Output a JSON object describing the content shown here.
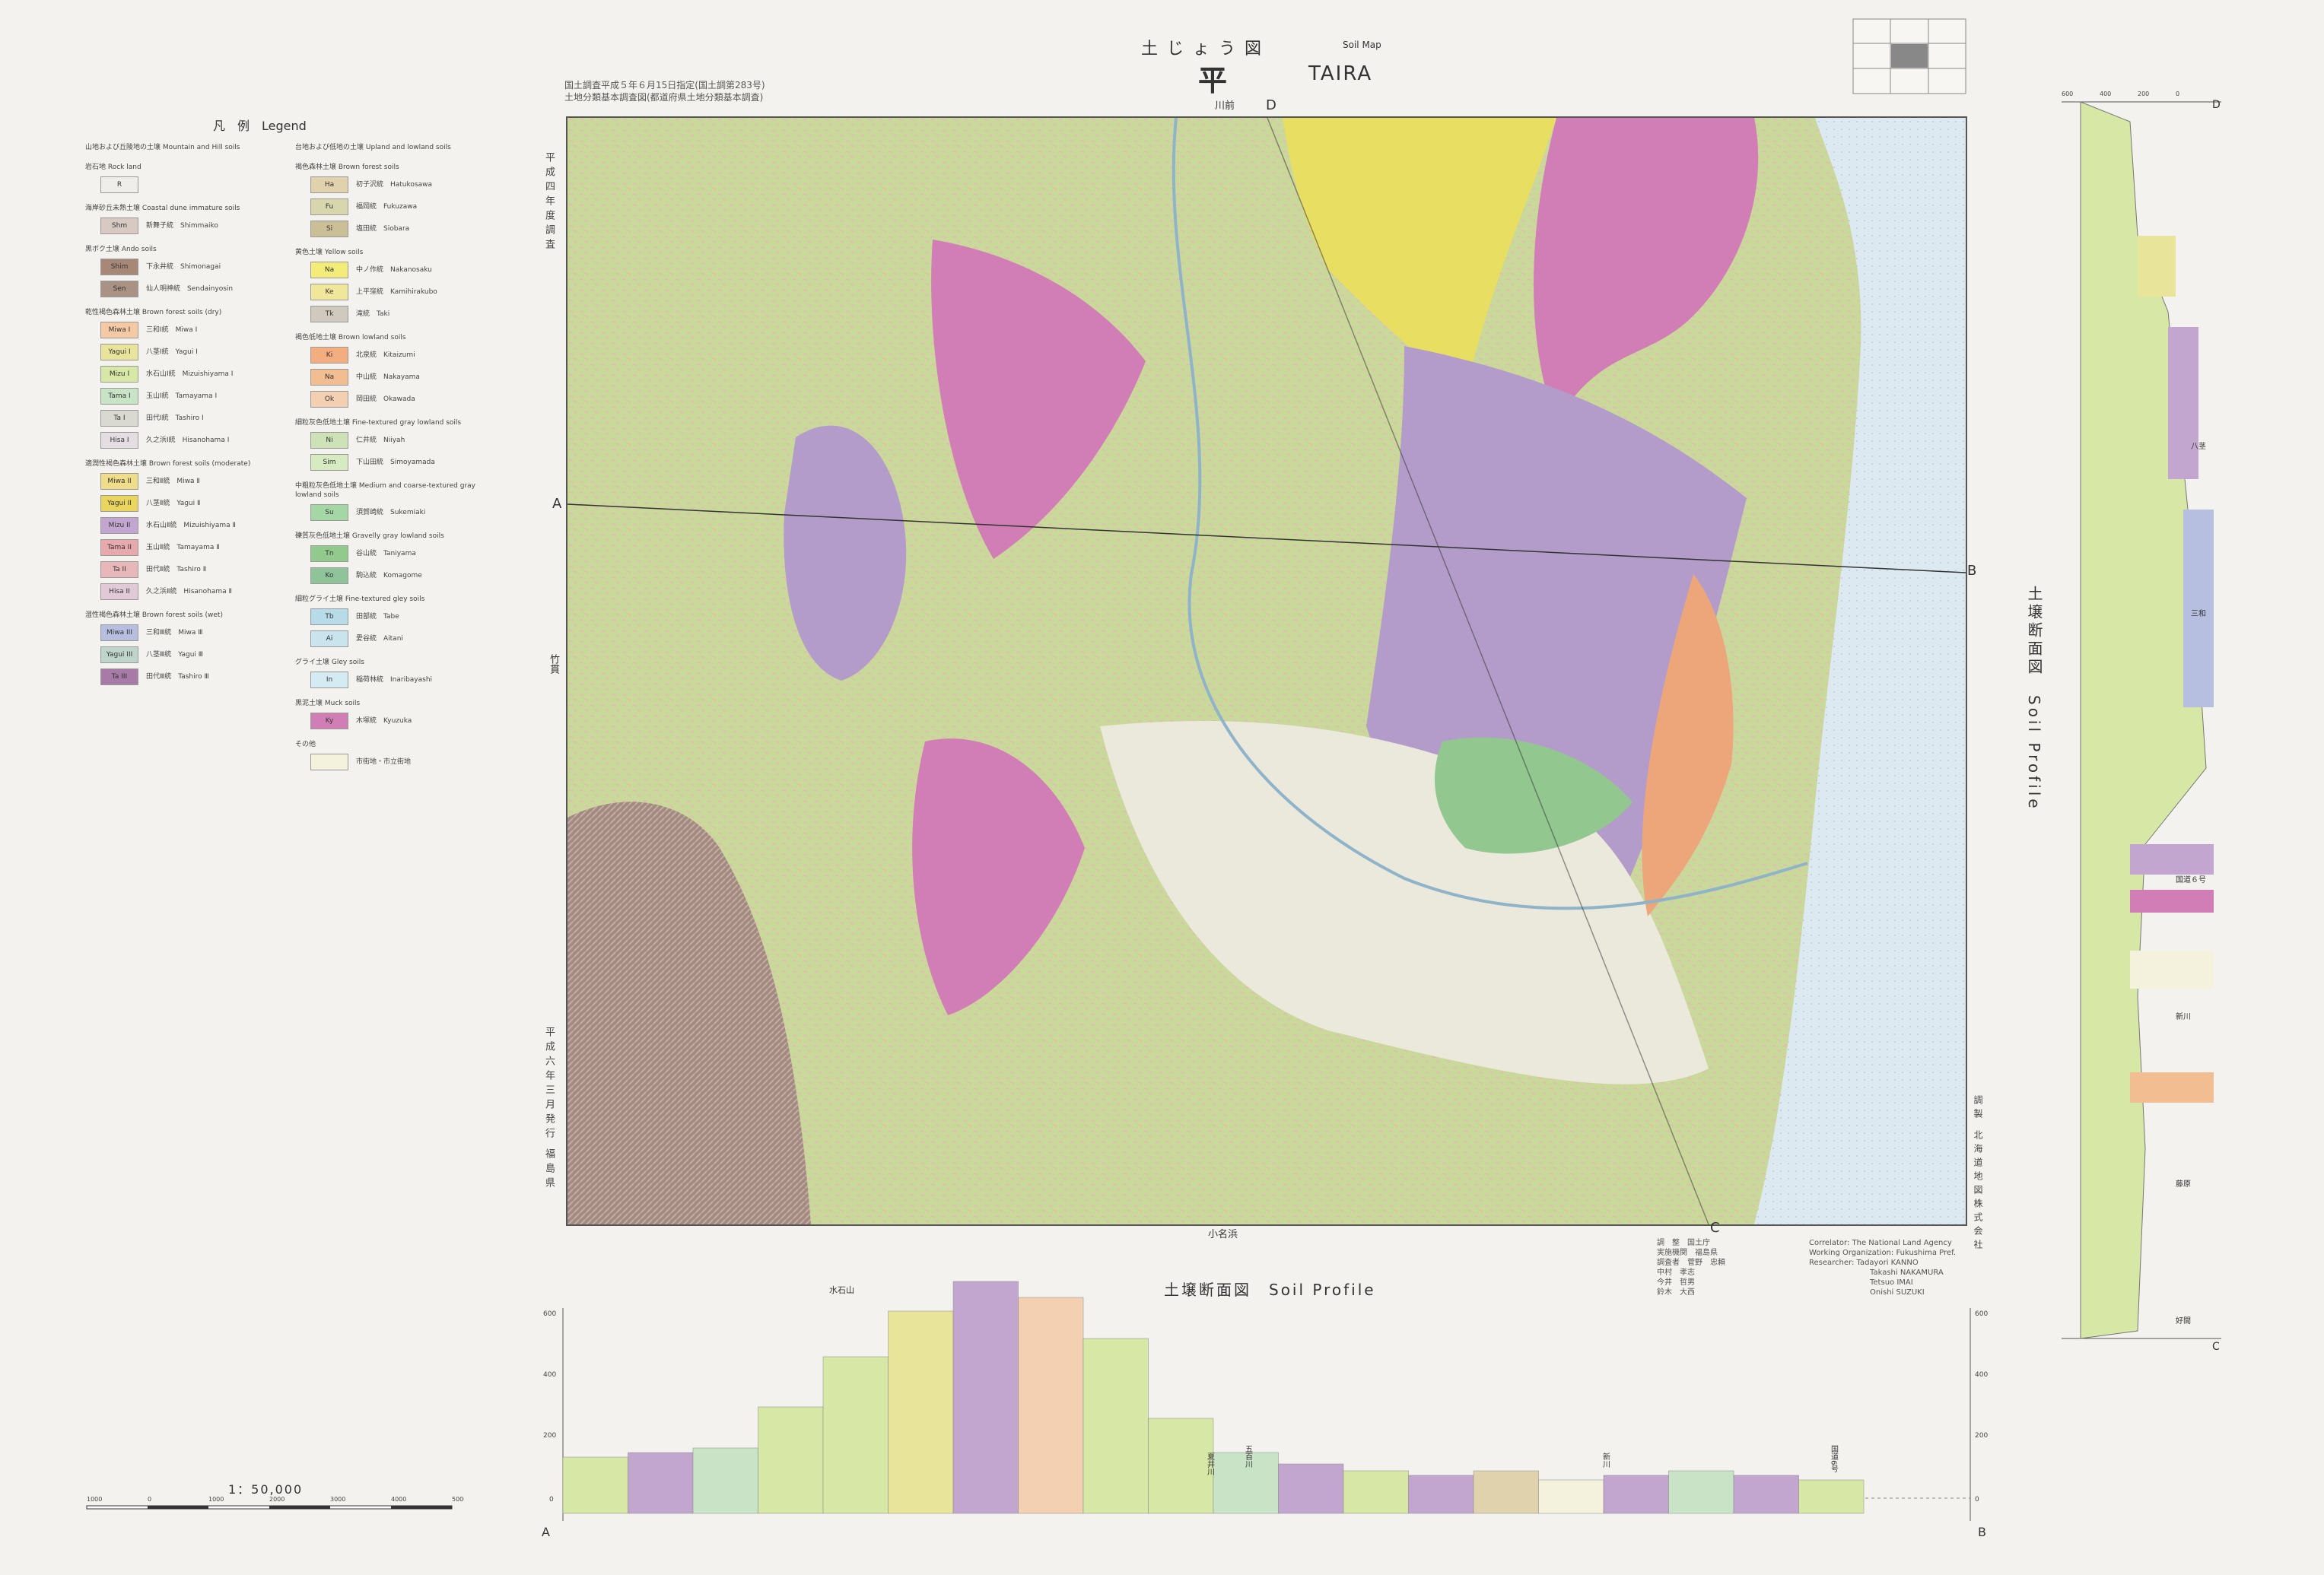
{
  "header": {
    "title_jp": "土じょう図",
    "title_soilmap": "Soil Map",
    "title_kanji": "平",
    "title_en": "TAIRA",
    "note_line1": "国土調査平成５年６月15日指定(国土調第283号)",
    "note_line2": "土地分類基本調査図(都道府県土地分類基本調査)",
    "left_vertical": "平成四年度調査",
    "bottom_vertical": "平成六年三月発行",
    "prefecture_vertical": "福島県",
    "right_vertical": "調製 北海道地図株式会社"
  },
  "legend": {
    "title": "凡　例　Legend",
    "column1": [
      {
        "group": "山地および丘陵地の土壌 Mountain and Hill soils",
        "items": []
      },
      {
        "group": "岩石地 Rock land",
        "items": [
          {
            "code": "R",
            "name": "",
            "color": "#efeeea"
          }
        ]
      },
      {
        "group": "海岸砂丘未熟土壌 Coastal dune immature soils",
        "items": [
          {
            "code": "Shm",
            "name": "新舞子統　Shimmaiko",
            "color": "#d8c9c3"
          }
        ]
      },
      {
        "group": "黒ボク土壌 Ando soils",
        "items": [
          {
            "code": "Shim",
            "name": "下永井統　Shimonagai",
            "color": "#a78877"
          },
          {
            "code": "Sen",
            "name": "仙人明神統　Sendainyosin",
            "color": "#a99283"
          }
        ]
      },
      {
        "group": "乾性褐色森林土壌 Brown forest soils (dry)",
        "items": [
          {
            "code": "Miwa I",
            "name": "三和Ⅰ統　Miwa Ⅰ",
            "color": "#f6c9a5"
          },
          {
            "code": "Yagui I",
            "name": "八茎Ⅰ統　Yagui Ⅰ",
            "color": "#e8e59a"
          },
          {
            "code": "Mizu I",
            "name": "水石山Ⅰ統　Mizuishiyama Ⅰ",
            "color": "#d7e7a6"
          },
          {
            "code": "Tama I",
            "name": "玉山Ⅰ統　Tamayama Ⅰ",
            "color": "#c9e3c7"
          },
          {
            "code": "Ta I",
            "name": "田代Ⅰ統　Tashiro Ⅰ",
            "color": "#d9d9d2"
          },
          {
            "code": "Hisa I",
            "name": "久之浜Ⅰ統　Hisanohama Ⅰ",
            "color": "#e4dde2"
          }
        ]
      },
      {
        "group": "適潤性褐色森林土壌 Brown forest soils (moderate)",
        "items": [
          {
            "code": "Miwa II",
            "name": "三和Ⅱ統　Miwa Ⅱ",
            "color": "#f0dd8a"
          },
          {
            "code": "Yagui II",
            "name": "八茎Ⅱ統　Yagui Ⅱ",
            "color": "#ead55f"
          },
          {
            "code": "Mizu II",
            "name": "水石山Ⅱ統　Mizuishiyama Ⅱ",
            "color": "#c3a6cf"
          },
          {
            "code": "Tama II",
            "name": "玉山Ⅱ統　Tamayama Ⅱ",
            "color": "#e8a9ad"
          },
          {
            "code": "Ta II",
            "name": "田代Ⅱ統　Tashiro Ⅱ",
            "color": "#e7b7b9"
          },
          {
            "code": "Hisa II",
            "name": "久之浜Ⅱ統　Hisanohama Ⅱ",
            "color": "#e1c9d8"
          }
        ]
      },
      {
        "group": "湿性褐色森林土壌 Brown forest soils (wet)",
        "items": [
          {
            "code": "Miwa III",
            "name": "三和Ⅲ統　Miwa Ⅲ",
            "color": "#b6bfe0"
          },
          {
            "code": "Yagui III",
            "name": "八茎Ⅲ統　Yagui Ⅲ",
            "color": "#bfd5cc"
          },
          {
            "code": "Ta III",
            "name": "田代Ⅲ統　Tashiro Ⅲ",
            "color": "#a77aa8"
          }
        ]
      }
    ],
    "column2": [
      {
        "group": "台地および低地の土壌 Upland and lowland soils",
        "items": []
      },
      {
        "group": "褐色森林土壌 Brown forest soils",
        "items": [
          {
            "code": "Ha",
            "name": "初子沢統　Hatukosawa",
            "color": "#e0d2ad"
          },
          {
            "code": "Fu",
            "name": "福岡統　Fukuzawa",
            "color": "#d7d6ac"
          },
          {
            "code": "Si",
            "name": "塩田統　Siobara",
            "color": "#cbbf97"
          }
        ]
      },
      {
        "group": "黄色土壌 Yellow soils",
        "items": [
          {
            "code": "Na",
            "name": "中ノ作統　Nakanosaku",
            "color": "#f3ec78"
          },
          {
            "code": "Ke",
            "name": "上平窪統　Kamihirakubo",
            "color": "#f1e79b"
          },
          {
            "code": "Tk",
            "name": "滝統　Taki",
            "color": "#cfc9be"
          }
        ]
      },
      {
        "group": "褐色低地土壌 Brown lowland soils",
        "items": [
          {
            "code": "Ki",
            "name": "北泉統　Kitaizumi",
            "color": "#f3ad7e"
          },
          {
            "code": "Na",
            "name": "中山統　Nakayama",
            "color": "#f2bd91"
          },
          {
            "code": "Ok",
            "name": "岡田統　Okawada",
            "color": "#f4d0b2"
          }
        ]
      },
      {
        "group": "細粒灰色低地土壌 Fine-textured gray lowland soils",
        "items": [
          {
            "code": "Ni",
            "name": "仁井統　Niiyah",
            "color": "#cde3b7"
          },
          {
            "code": "Sim",
            "name": "下山田統　Simoyamada",
            "color": "#d7ebc2"
          }
        ]
      },
      {
        "group": "中粗粒灰色低地土壌 Medium and coarse-textured gray lowland soils",
        "items": [
          {
            "code": "Su",
            "name": "須賀崎統　Sukemiaki",
            "color": "#a5d7a6"
          }
        ]
      },
      {
        "group": "礫質灰色低地土壌 Gravelly gray lowland soils",
        "items": [
          {
            "code": "Tn",
            "name": "谷山統　Taniyama",
            "color": "#92c98c"
          },
          {
            "code": "Ko",
            "name": "駒込統　Komagome",
            "color": "#8fc39a"
          }
        ]
      },
      {
        "group": "細粒グライ土壌 Fine-textured gley soils",
        "items": [
          {
            "code": "Tb",
            "name": "田部統　Tabe",
            "color": "#b8dbe9"
          },
          {
            "code": "Ai",
            "name": "愛谷統　Aitani",
            "color": "#c9e4ed"
          }
        ]
      },
      {
        "group": "グライ土壌 Gley soils",
        "items": [
          {
            "code": "In",
            "name": "稲荷林統　Inaribayashi",
            "color": "#d4ebf4"
          }
        ]
      },
      {
        "group": "黒泥土壌 Muck soils",
        "items": [
          {
            "code": "Ky",
            "name": "木塚統　Kyuzuka",
            "color": "#d27eb6"
          }
        ]
      },
      {
        "group": "その他",
        "items": [
          {
            "code": "",
            "name": "市街地・市立街地",
            "color": "#f4f2dc"
          }
        ]
      }
    ]
  },
  "map": {
    "labels": {
      "D": "D",
      "C": "C",
      "A": "A",
      "B": "B",
      "top_place": "川前",
      "bottom_place": "小名浜",
      "left_place": "竹貫"
    },
    "colors": {
      "base": "#c9d99a",
      "magenta": "#d27eb6",
      "purple": "#b39cc9",
      "yellow": "#e8de62",
      "sea": "#dce9f0",
      "urban": "#ebe8dc",
      "green": "#93c790",
      "brown": "#a38a80",
      "orange": "#eca67a"
    }
  },
  "profile_h": {
    "title": "土壌断面図　Soil Profile",
    "peak_label": "水石山",
    "left_axis": [
      "600",
      "400",
      "200",
      "0"
    ],
    "right_axis": [
      "600",
      "400",
      "200",
      "0"
    ],
    "end_left": "A",
    "end_right": "B",
    "place_labels": [
      "夏井川",
      "五百川",
      "新川",
      "国道6号"
    ],
    "layers": [
      {
        "profile": 0.18,
        "color": "#d7e7a6"
      },
      {
        "profile": 0.2,
        "color": "#c3a6cf"
      },
      {
        "profile": 0.22,
        "color": "#c9e3c7"
      },
      {
        "profile": 0.4,
        "color": "#d7e7a6"
      },
      {
        "profile": 0.62,
        "color": "#d7e7a6"
      },
      {
        "profile": 0.82,
        "color": "#e8e59a"
      },
      {
        "profile": 0.95,
        "color": "#c3a6cf"
      },
      {
        "profile": 0.88,
        "color": "#f4d0b2"
      },
      {
        "profile": 0.7,
        "color": "#d7e7a6"
      },
      {
        "profile": 0.35,
        "color": "#d7e7a6"
      },
      {
        "profile": 0.2,
        "color": "#c9e3c7"
      },
      {
        "profile": 0.15,
        "color": "#c3a6cf"
      },
      {
        "profile": 0.12,
        "color": "#d7e7a6"
      },
      {
        "profile": 0.1,
        "color": "#c3a6cf"
      },
      {
        "profile": 0.12,
        "color": "#e0d2ad"
      },
      {
        "profile": 0.08,
        "color": "#f4f2dc"
      },
      {
        "profile": 0.1,
        "color": "#c3a6cf"
      },
      {
        "profile": 0.12,
        "color": "#c9e3c7"
      },
      {
        "profile": 0.1,
        "color": "#c3a6cf"
      },
      {
        "profile": 0.08,
        "color": "#d7e7a6"
      }
    ]
  },
  "profile_v": {
    "title": "土壌断面図　Soil Profile",
    "top_label": "D",
    "bottom_label": "C",
    "axis": [
      "600",
      "400",
      "200",
      "0"
    ],
    "place_labels": [
      "八茎",
      "三和",
      "国道６号",
      "新川",
      "藤原",
      "好間"
    ]
  },
  "scale": {
    "ratio": "1：50,000",
    "ticks": [
      "1000",
      "0",
      "1000",
      "2000",
      "3000",
      "4000",
      "5000M"
    ]
  },
  "credits": {
    "lines": [
      "Correlator: The National Land Agency",
      "Working Organization: Fukushima Pref.",
      "Researcher: Tadayori KANNO",
      "Takashi NAKAMURA",
      "Tetsuo IMAI",
      "Onishi SUZUKI"
    ],
    "jp_lines": [
      "調　整　国土庁",
      "実施機関　福島県",
      "調査者　菅野　忠頼",
      "中村　孝志",
      "今井　哲男",
      "鈴木　大西"
    ]
  }
}
